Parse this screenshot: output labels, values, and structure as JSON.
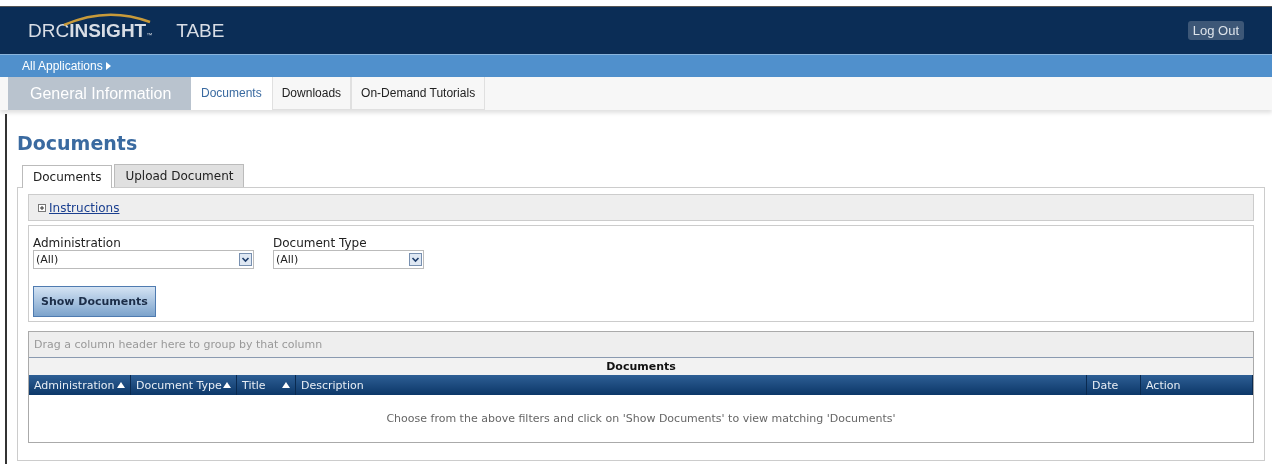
{
  "header": {
    "logo": {
      "prefix": "DRC",
      "emphasis": "INSIGHT",
      "mark": "™"
    },
    "app_name": "TABE",
    "logout": "Log Out"
  },
  "app_bar": {
    "link": "All Applications"
  },
  "nav": {
    "section": "General Information",
    "tabs": [
      {
        "label": "Documents",
        "selected": true
      },
      {
        "label": "Downloads",
        "selected": false
      },
      {
        "label": "On-Demand Tutorials",
        "selected": false
      }
    ]
  },
  "page_title": "Documents",
  "sub_tabs": [
    {
      "label": "Documents",
      "selected": true
    },
    {
      "label": "Upload Document",
      "selected": false
    }
  ],
  "instructions": {
    "label": "Instructions",
    "expanded": false
  },
  "filters": [
    {
      "label": "Administration",
      "value": "(All)"
    },
    {
      "label": "Document Type",
      "value": "(All)"
    }
  ],
  "show_button": "Show Documents",
  "grid": {
    "group_hint": "Drag a column header here to group by that column",
    "caption": "Documents",
    "columns": [
      {
        "label": "Administration",
        "sorted": true
      },
      {
        "label": "Document Type",
        "sorted": true
      },
      {
        "label": "Title",
        "sorted": true
      },
      {
        "label": "Description",
        "sorted": false
      },
      {
        "label": "Date",
        "sorted": false
      },
      {
        "label": "Action",
        "sorted": false
      }
    ],
    "empty_message": "Choose from the above filters and click on 'Show Documents' to view matching 'Documents'"
  }
}
